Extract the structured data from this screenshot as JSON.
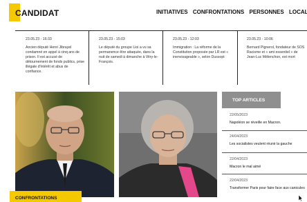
{
  "header": {
    "logo": "CANDIDAT",
    "nav": [
      "INITIATIVES",
      "CONFRONTATIONS",
      "PERSONNES",
      "LOCALE"
    ]
  },
  "news": [
    {
      "date": "23.05.23 - 16:33",
      "text": "Ancien député Henri Jibrayel condamné en appel à cinq ans de prison. Il est accusé de détournement de fonds publics, prise illégale d'intérêt et abus de confiance."
    },
    {
      "date": "23.05.23 - 15:03",
      "text": "Le député du groupe Lioi a vu sa permanence être attaquée, dans la nuit de samedi à dimanche à Vitry-le-François."
    },
    {
      "date": "23.05.23 - 12:03",
      "text": "Immigration : La réforme de la Constitution proposée par LR est « inenvisageable », selon Dussopt"
    },
    {
      "date": "23.05.23 - 10:06",
      "text": "Bernard Pignerol, fondateur de SOS Racisme et « ami essentiel » de Jean-Luc Mélenchon, est mort"
    }
  ],
  "featured": {
    "badge": "CONFRONTATIONS"
  },
  "sidebar": {
    "title": "TOP ARTICLES",
    "items": [
      {
        "date": "22/05/2023",
        "title": "Napoléon se réveille en Macron."
      },
      {
        "date": "24/04/2023",
        "title": "Les socialistes veulent réunir la gauche"
      },
      {
        "date": "22/04/2023",
        "title": "Macron le mal aimé"
      },
      {
        "date": "22/04/2023",
        "title": "Transformer Paris pour faire face aux canicules"
      }
    ]
  },
  "colors": {
    "accent": "#f5c900",
    "sidebar_header": "#8f8f8f"
  },
  "icons": {
    "cursor": "mouse-pointer-icon"
  }
}
